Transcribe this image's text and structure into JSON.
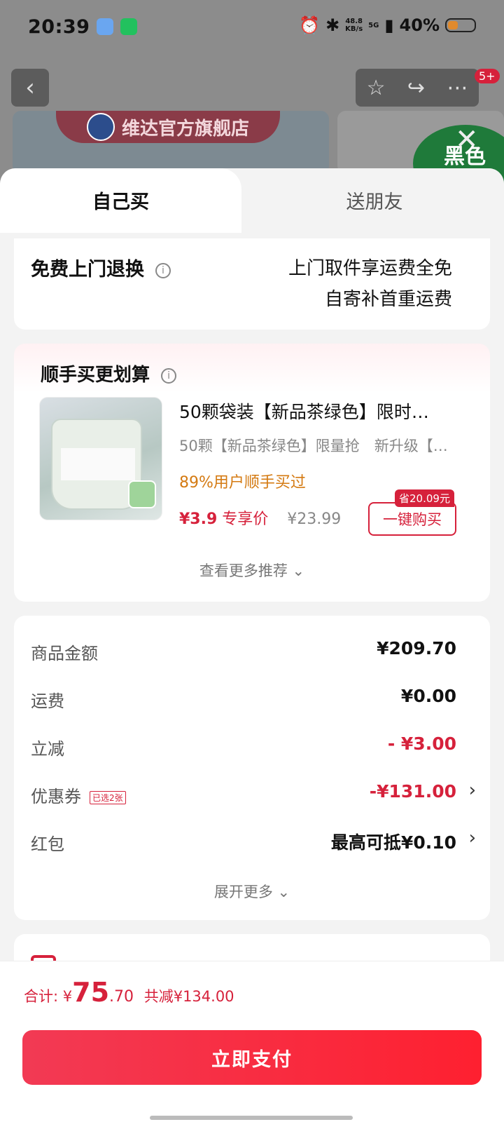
{
  "status_bar": {
    "time": "20:39",
    "net_speed_top": "48.8",
    "net_speed_bottom": "KB/s",
    "network": "5G",
    "battery": "40%"
  },
  "background": {
    "shop_name": "维达官方旗舰店",
    "notif_badge": "5+",
    "ad_text": "黑色"
  },
  "tabs": [
    {
      "label": "自己买"
    },
    {
      "label": "送朋友"
    }
  ],
  "returns": {
    "title": "免费上门退换",
    "line1": "上门取件享运费全免",
    "line2": "自寄补首重运费"
  },
  "recommend": {
    "title": "顺手买更划算",
    "product_name": "50颗袋装【新品茶绿色】限时…",
    "product_spec": "50颗【新品茶绿色】限量抢　新升级【…",
    "buyers": "89%用户顺手买过",
    "price_now": "¥3.9",
    "price_label": "专享价",
    "price_orig": "¥23.99",
    "save_tag": "省20.09元",
    "buy_button": "一键购买",
    "more": "查看更多推荐 ⌄"
  },
  "summary": {
    "rows": [
      {
        "label": "商品金额",
        "value": "¥209.70"
      },
      {
        "label": "运费",
        "value": "¥0.00"
      },
      {
        "label": "立减",
        "value": "- ¥3.00"
      },
      {
        "label": "优惠券",
        "tag": "已选2张",
        "value": "-¥131.00"
      },
      {
        "label": "红包",
        "value": "最高可抵¥0.10"
      }
    ],
    "expand": "展开更多 ⌄"
  },
  "footer": {
    "total_label": "合计: ¥",
    "total_int": "75",
    "total_dec": ".70",
    "saved": "共减¥134.00",
    "pay_button": "立即支付"
  },
  "colors": {
    "accent": "#d6213b",
    "orange": "#d47a12"
  }
}
